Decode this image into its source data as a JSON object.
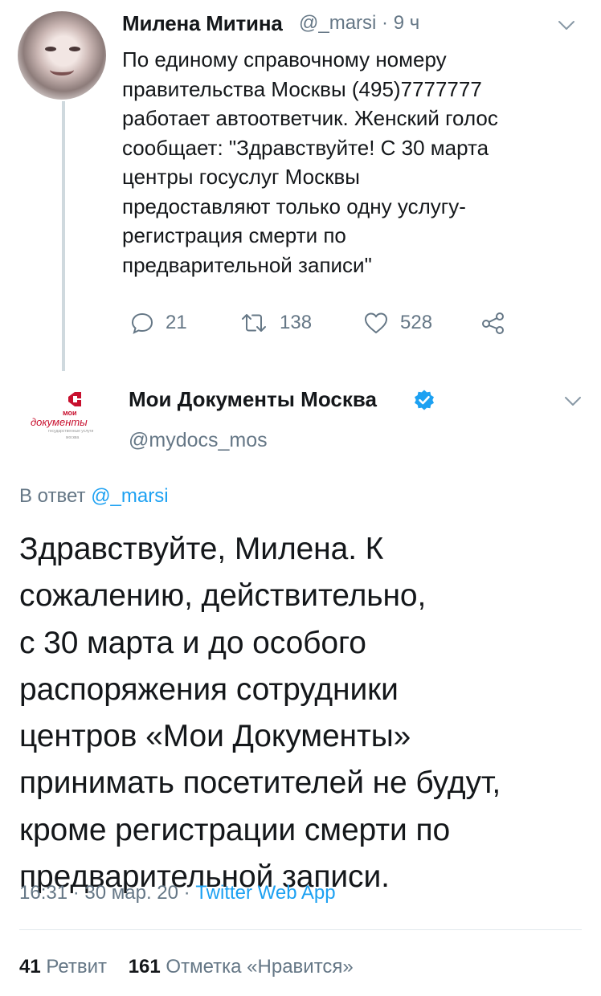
{
  "tweet1": {
    "author_name": "Милена Митина",
    "handle": "@_marsi",
    "separator": "·",
    "time_ago": "9 ч",
    "body_lines": [
      "По единому справочному номеру",
      "правительства Москвы (495)7777777",
      "работает автоответчик. Женский голос",
      "сообщает: \"Здравствуйте!  С 30 марта",
      "центры госуслуг Москвы",
      "предоставляют только одну услугу-",
      "регистрация смерти по",
      "предварительной записи\""
    ],
    "reply_count": "21",
    "retweet_count": "138",
    "like_count": "528"
  },
  "tweet2": {
    "author_name": "Мои Документы Москва",
    "handle": "@mydocs_mos",
    "logo_text_top": "мои",
    "logo_text_bottom": "документы",
    "logo_caption_1": "государственные услуги",
    "logo_caption_2": "москва",
    "reply_prefix": "В ответ",
    "reply_handle": "@_marsi",
    "body_lines": [
      "Здравствуйте, Милена. К",
      "сожалению, действительно,",
      "с 30 марта и до особого",
      "распоряжения сотрудники",
      "центров «Мои Документы»",
      "принимать посетителей не будут,",
      "кроме регистрации смерти по",
      "предварительной записи."
    ],
    "timestamp": "16:31 · 30 мар. 20 · ",
    "source": "Twitter Web App",
    "retweets_count": "41",
    "retweets_label": "Ретвит",
    "likes_count": "161",
    "likes_label": "Отметка «Нравится»"
  },
  "colors": {
    "text": "#14171a",
    "secondary": "#657786",
    "link": "#1da1f2",
    "brand_red": "#c8102e"
  },
  "icons": [
    "reply-icon",
    "retweet-icon",
    "like-icon",
    "share-icon",
    "chevron-down-icon",
    "verified-badge-icon"
  ]
}
